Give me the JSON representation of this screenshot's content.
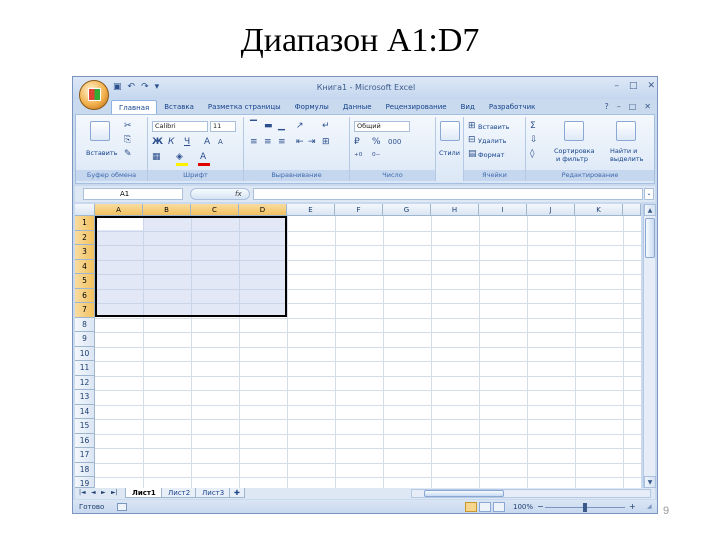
{
  "slide": {
    "title": "Диапазон A1:D7",
    "page_number": "9"
  },
  "window": {
    "title": "Книга1 - Microsoft Excel",
    "minimize": "–",
    "restore": "□",
    "close": "✕"
  },
  "qat": {
    "save": "▣",
    "undo": "↶",
    "redo": "↷",
    "customize": "▾"
  },
  "ribbon_tabs": [
    {
      "label": "Главная",
      "active": true
    },
    {
      "label": "Вставка"
    },
    {
      "label": "Разметка страницы"
    },
    {
      "label": "Формулы"
    },
    {
      "label": "Данные"
    },
    {
      "label": "Рецензирование"
    },
    {
      "label": "Вид"
    },
    {
      "label": "Разработчик"
    }
  ],
  "ribbon_controls": {
    "help": "?",
    "minimize": "–",
    "restore": "□",
    "close": "✕"
  },
  "groups": {
    "clipboard": {
      "label": "Буфер обмена",
      "paste": "Вставить"
    },
    "font": {
      "label": "Шрифт",
      "font_name": "Calibri",
      "font_size": "11",
      "bold": "Ж",
      "italic": "К",
      "underline": "Ч",
      "grow": "A",
      "shrink": "A"
    },
    "alignment": {
      "label": "Выравнивание"
    },
    "number": {
      "label": "Число",
      "format": "Общий",
      "percent": "%",
      "thousands": "000"
    },
    "styles": {
      "label": "Стили",
      "button": "Стили"
    },
    "cells": {
      "label": "Ячейки",
      "insert": "Вставить",
      "delete": "Удалить",
      "format": "Формат"
    },
    "editing": {
      "label": "Редактирование",
      "sum": "Σ",
      "sort_line1": "Сортировка",
      "sort_line2": "и фильтр",
      "find_line1": "Найти и",
      "find_line2": "выделить"
    }
  },
  "formula_bar": {
    "name_box": "A1",
    "fx": "fx",
    "value": ""
  },
  "columns": [
    "A",
    "B",
    "C",
    "D",
    "E",
    "F",
    "G",
    "H",
    "I",
    "J",
    "K"
  ],
  "rows": [
    "1",
    "2",
    "3",
    "4",
    "5",
    "6",
    "7",
    "8",
    "9",
    "10",
    "11",
    "12",
    "13",
    "14",
    "15",
    "16",
    "17",
    "18",
    "19"
  ],
  "selection": {
    "range": "A1:D7",
    "active_cell": "A1"
  },
  "sheets": [
    {
      "label": "Лист1",
      "active": true
    },
    {
      "label": "Лист2"
    },
    {
      "label": "Лист3"
    }
  ],
  "sheet_nav": [
    "|◄",
    "◄",
    "►",
    "►|"
  ],
  "status": {
    "ready": "Готово",
    "zoom": "100%",
    "zoom_minus": "−",
    "zoom_plus": "+"
  }
}
